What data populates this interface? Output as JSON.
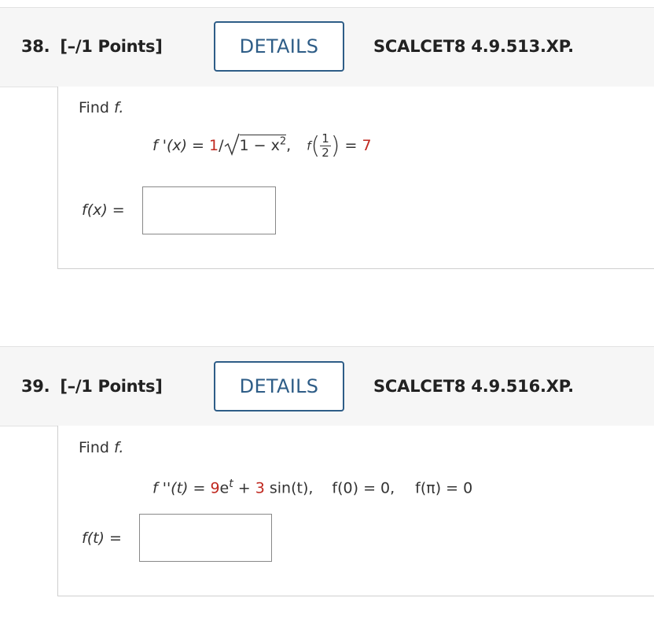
{
  "q38": {
    "number": "38.",
    "points": "[–/1 Points]",
    "details_label": "DETAILS",
    "code": "SCALCET8 4.9.513.XP.",
    "prompt_word": "Find",
    "prompt_var": "f.",
    "eq": {
      "lhs": "f '(x) = ",
      "one": "1",
      "slash": "/",
      "radicand_a": "1 − x",
      "radicand_exp": "2",
      "comma": ",",
      "f_label": "f",
      "frac_num": "1",
      "frac_den": "2",
      "equals": " = ",
      "value": "7"
    },
    "answer_label": "f(x) ="
  },
  "q39": {
    "number": "39.",
    "points": "[–/1 Points]",
    "details_label": "DETAILS",
    "code": "SCALCET8 4.9.516.XP.",
    "prompt_word": "Find",
    "prompt_var": "f.",
    "eq": {
      "lhs": "f ''(t) = ",
      "coef1": "9",
      "e": "e",
      "exp": "t",
      "plus": " + ",
      "coef2": "3",
      "sin": " sin(t),",
      "cond1": "f(0) = 0,",
      "cond2": "f(π) = 0"
    },
    "answer_label": "f(t) ="
  },
  "colors": {
    "accent": "#2e5d87",
    "highlight": "#c0281f",
    "header_bg": "#f6f6f6"
  }
}
